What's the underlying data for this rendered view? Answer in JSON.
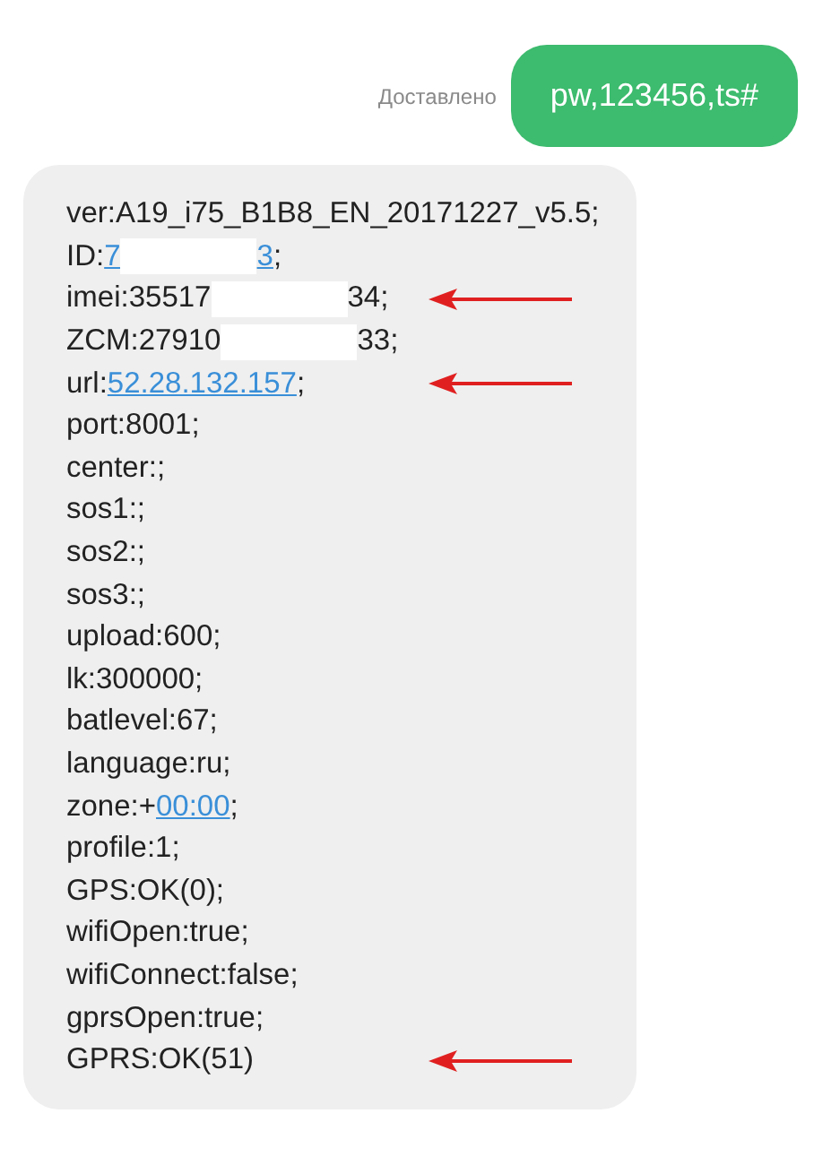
{
  "outgoing": {
    "status": "Доставлено",
    "text": "pw,123456,ts#"
  },
  "incoming": {
    "lines": [
      {
        "arrow": false,
        "segments": [
          {
            "kind": "text",
            "text": "ver:A19_i75_B1B8_EN_20171227_v5.5;"
          }
        ]
      },
      {
        "arrow": false,
        "segments": [
          {
            "kind": "text",
            "text": "ID:"
          },
          {
            "kind": "link",
            "text": "7"
          },
          {
            "kind": "redacted"
          },
          {
            "kind": "link",
            "text": "3"
          },
          {
            "kind": "text",
            "text": ";"
          }
        ]
      },
      {
        "arrow": true,
        "segments": [
          {
            "kind": "text",
            "text": "imei:35517"
          },
          {
            "kind": "redacted"
          },
          {
            "kind": "text",
            "text": "34;"
          }
        ]
      },
      {
        "arrow": false,
        "segments": [
          {
            "kind": "text",
            "text": "ZCM:27910"
          },
          {
            "kind": "redacted"
          },
          {
            "kind": "text",
            "text": "33;"
          }
        ]
      },
      {
        "arrow": true,
        "segments": [
          {
            "kind": "text",
            "text": "url:"
          },
          {
            "kind": "link",
            "text": "52.28.132.157"
          },
          {
            "kind": "text",
            "text": ";"
          }
        ]
      },
      {
        "arrow": false,
        "segments": [
          {
            "kind": "text",
            "text": "port:8001;"
          }
        ]
      },
      {
        "arrow": false,
        "segments": [
          {
            "kind": "text",
            "text": "center:;"
          }
        ]
      },
      {
        "arrow": false,
        "segments": [
          {
            "kind": "text",
            "text": "sos1:;"
          }
        ]
      },
      {
        "arrow": false,
        "segments": [
          {
            "kind": "text",
            "text": "sos2:;"
          }
        ]
      },
      {
        "arrow": false,
        "segments": [
          {
            "kind": "text",
            "text": "sos3:;"
          }
        ]
      },
      {
        "arrow": false,
        "segments": [
          {
            "kind": "text",
            "text": "upload:600;"
          }
        ]
      },
      {
        "arrow": false,
        "segments": [
          {
            "kind": "text",
            "text": "lk:300000;"
          }
        ]
      },
      {
        "arrow": false,
        "segments": [
          {
            "kind": "text",
            "text": "batlevel:67;"
          }
        ]
      },
      {
        "arrow": false,
        "segments": [
          {
            "kind": "text",
            "text": "language:ru;"
          }
        ]
      },
      {
        "arrow": false,
        "segments": [
          {
            "kind": "text",
            "text": "zone:+"
          },
          {
            "kind": "link",
            "text": "00:00"
          },
          {
            "kind": "text",
            "text": ";"
          }
        ]
      },
      {
        "arrow": false,
        "segments": [
          {
            "kind": "text",
            "text": "profile:1;"
          }
        ]
      },
      {
        "arrow": false,
        "segments": [
          {
            "kind": "text",
            "text": "GPS:OK(0);"
          }
        ]
      },
      {
        "arrow": false,
        "segments": [
          {
            "kind": "text",
            "text": "wifiOpen:true;"
          }
        ]
      },
      {
        "arrow": false,
        "segments": [
          {
            "kind": "text",
            "text": "wifiConnect:false;"
          }
        ]
      },
      {
        "arrow": false,
        "segments": [
          {
            "kind": "text",
            "text": "gprsOpen:true;"
          }
        ]
      },
      {
        "arrow": true,
        "segments": [
          {
            "kind": "text",
            "text": "GPRS:OK(51)"
          }
        ]
      }
    ]
  }
}
